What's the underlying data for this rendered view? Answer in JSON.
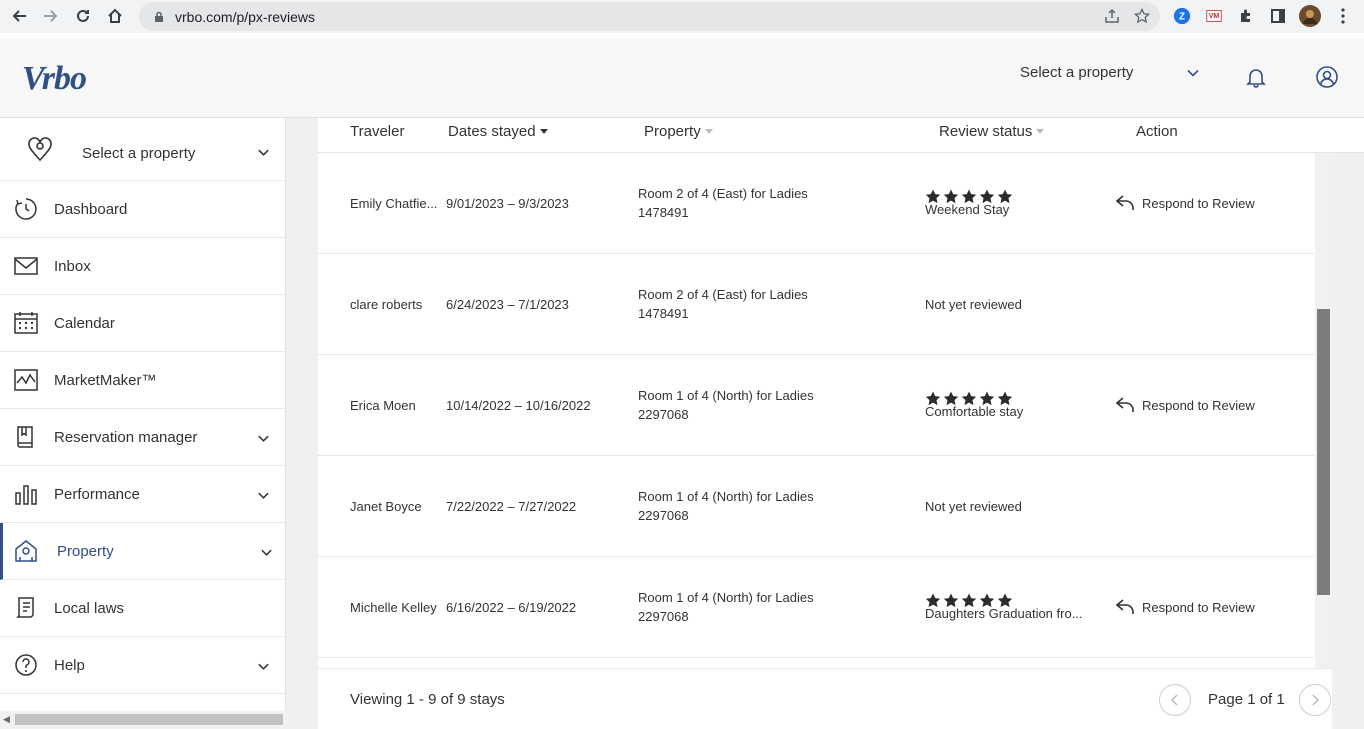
{
  "browser": {
    "url": "vrbo.com/p/px-reviews",
    "icons": [
      "back-icon",
      "forward-icon",
      "reload-icon",
      "home-icon",
      "lock-icon",
      "share-icon",
      "star-icon",
      "extension-icon",
      "puzzle-icon",
      "sidepanel-icon",
      "profile-avatar",
      "kebab-menu-icon"
    ],
    "ext_vm_label": "VM"
  },
  "header": {
    "logo": "Vrbo",
    "property_select": "Select a property",
    "icons": [
      "chevron-down-icon",
      "bell-icon",
      "user-icon"
    ]
  },
  "sidebar": {
    "property_select": "Select a property",
    "items": [
      {
        "label": "Dashboard",
        "icon": "dashboard-icon",
        "chevron": false,
        "active": false
      },
      {
        "label": "Inbox",
        "icon": "inbox-icon",
        "chevron": false,
        "active": false
      },
      {
        "label": "Calendar",
        "icon": "calendar-icon",
        "chevron": false,
        "active": false
      },
      {
        "label": "MarketMaker™",
        "icon": "marketmaker-icon",
        "chevron": false,
        "active": false
      },
      {
        "label": "Reservation manager",
        "icon": "reservation-icon",
        "chevron": true,
        "active": false
      },
      {
        "label": "Performance",
        "icon": "performance-icon",
        "chevron": true,
        "active": false
      },
      {
        "label": "Property",
        "icon": "property-icon",
        "chevron": true,
        "active": true
      },
      {
        "label": "Local laws",
        "icon": "local-laws-icon",
        "chevron": false,
        "active": false
      },
      {
        "label": "Help",
        "icon": "help-icon",
        "chevron": true,
        "active": false
      }
    ]
  },
  "table": {
    "headers": {
      "traveler": "Traveler",
      "dates": "Dates stayed",
      "property": "Property",
      "status": "Review status",
      "action": "Action"
    },
    "rows": [
      {
        "traveler": "Emily Chatfie...",
        "dates": "9/01/2023 – 9/3/2023",
        "property": "Room 2 of 4 (East) for Ladies",
        "property_id": "1478491",
        "stars": 5,
        "review_title": "Weekend Stay",
        "status_text": "",
        "action": "Respond to Review"
      },
      {
        "traveler": "clare roberts",
        "dates": "6/24/2023 – 7/1/2023",
        "property": "Room 2 of 4 (East) for Ladies",
        "property_id": "1478491",
        "stars": 0,
        "review_title": "",
        "status_text": "Not yet reviewed",
        "action": ""
      },
      {
        "traveler": "Erica Moen",
        "dates": "10/14/2022 – 10/16/2022",
        "property": "Room 1 of 4 (North) for Ladies",
        "property_id": "2297068",
        "stars": 5,
        "review_title": "Comfortable stay",
        "status_text": "",
        "action": "Respond to Review"
      },
      {
        "traveler": "Janet Boyce",
        "dates": "7/22/2022 – 7/27/2022",
        "property": "Room 1 of 4 (North) for Ladies",
        "property_id": "2297068",
        "stars": 0,
        "review_title": "",
        "status_text": "Not yet reviewed",
        "action": ""
      },
      {
        "traveler": "Michelle Kelley",
        "dates": "6/16/2022 – 6/19/2022",
        "property": "Room 1 of 4 (North) for Ladies",
        "property_id": "2297068",
        "stars": 5,
        "review_title": "Daughters Graduation fro...",
        "status_text": "",
        "action": "Respond to Review"
      }
    ]
  },
  "footer": {
    "viewing": "Viewing 1 - 9 of 9 stays",
    "page": "Page 1 of 1"
  }
}
